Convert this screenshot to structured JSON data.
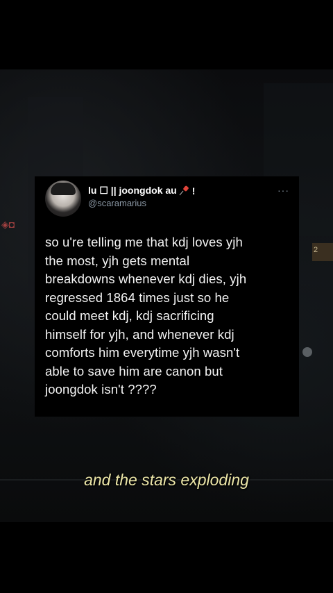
{
  "tweet": {
    "display_name": "lu ☐ || joongdok au",
    "name_suffix": "!",
    "handle": "@scaramarius",
    "more": "···",
    "text": "so u're telling me that kdj loves yjh\nthe most, yjh gets mental\nbreakdowns whenever kdj dies, yjh\nregressed 1864 times just so he\ncould meet kdj, kdj sacrificing\nhimself for yjh, and whenever kdj\ncomforts him everytime yjh wasn't\nable to save him are canon but\njoongdok isn't ????"
  },
  "video": {
    "caption": "and the stars exploding",
    "sign_text": "2"
  },
  "icons": {
    "pin": "pushpin-icon",
    "more": "more-options-icon"
  }
}
